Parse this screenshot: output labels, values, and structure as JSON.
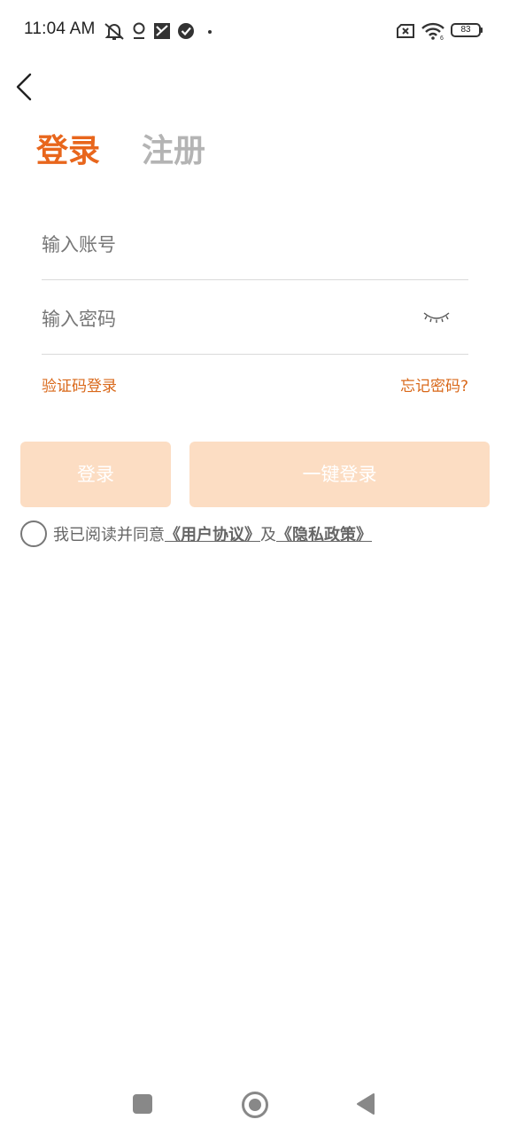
{
  "status_bar": {
    "time": "11:04 AM",
    "battery": "83",
    "icons": [
      "mute-icon",
      "location-icon",
      "app-notification-icon",
      "check-circle-icon",
      "dot-icon",
      "sim-error-icon",
      "wifi-icon",
      "battery-icon"
    ]
  },
  "header": {
    "back_icon": "chevron-left-icon"
  },
  "tabs": [
    {
      "label": "登录",
      "active": true
    },
    {
      "label": "注册",
      "active": false
    }
  ],
  "form": {
    "account_placeholder": "输入账号",
    "account_value": "",
    "password_placeholder": "输入密码",
    "password_value": "",
    "password_toggle_icon": "eye-closed-icon"
  },
  "links": {
    "sms_login": "验证码登录",
    "forgot_password": "忘记密码?"
  },
  "buttons": {
    "login": "登录",
    "one_click_login": "一键登录"
  },
  "agreement": {
    "checked": false,
    "prefix": "我已阅读并同意",
    "user_agreement": "《用户协议》",
    "and": "及",
    "privacy_policy": "《隐私政策》"
  },
  "nav_bar": {
    "items": [
      "recents-icon",
      "home-icon",
      "back-icon"
    ]
  },
  "colors": {
    "accent": "#E8661C",
    "link": "#D9681A",
    "button_disabled_bg": "#FCDDC3",
    "inactive_tab": "#B4B4B4"
  }
}
